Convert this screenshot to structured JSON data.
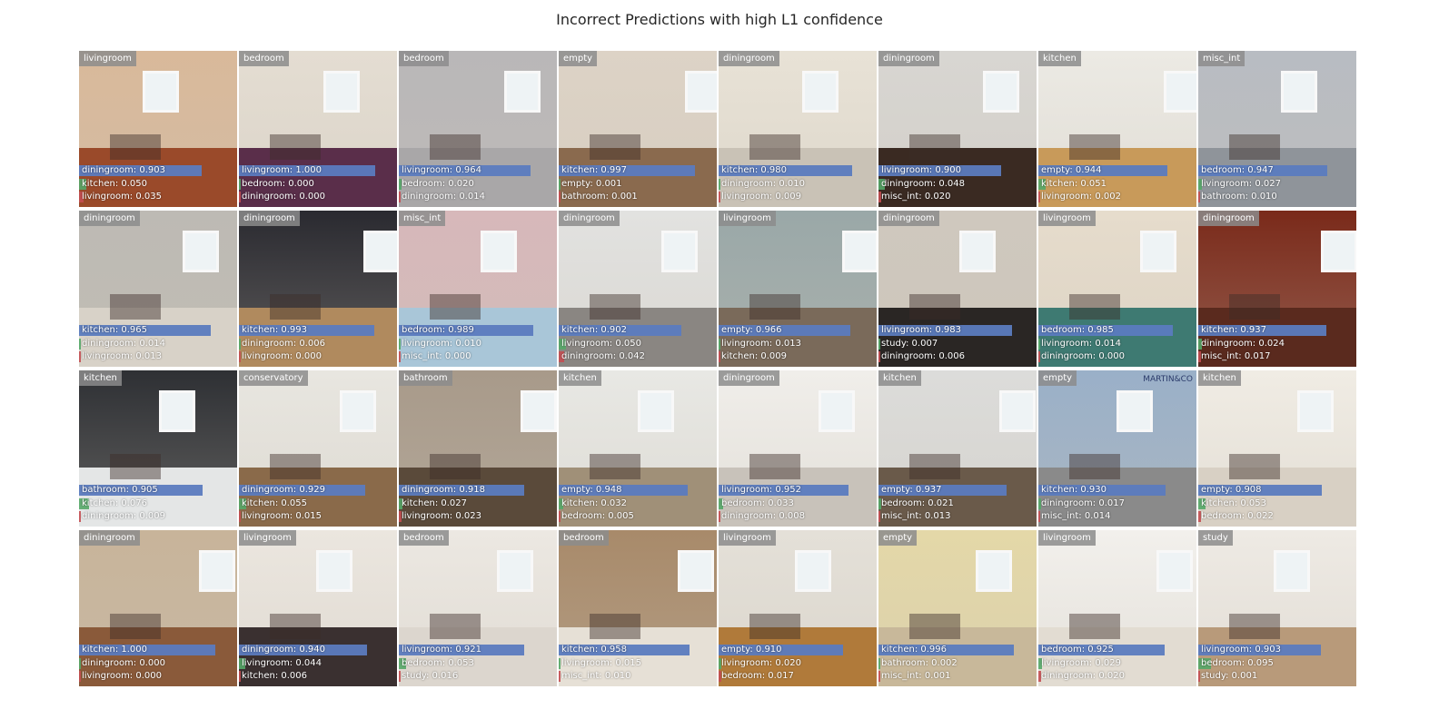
{
  "title": "Incorrect Predictions with high L1 confidence",
  "chart_data": {
    "type": "other",
    "title": "Incorrect Predictions with high L1 confidence",
    "grid": {
      "rows": 4,
      "cols": 8
    },
    "bar_colors": {
      "top": "#5b7bbf",
      "second": "#55a868",
      "third": "#c44e52"
    },
    "items": [
      {
        "truth": "livingroom",
        "palette": [
          "#d9b99a",
          "#9a4a2a"
        ],
        "preds": [
          {
            "label": "diningroom",
            "score": 0.903
          },
          {
            "label": "kitchen",
            "score": 0.05
          },
          {
            "label": "livingroom",
            "score": 0.035
          }
        ],
        "pred_text": [
          "diningroom: 0.903",
          "kitchen: 0.050",
          "livingroom: 0.035"
        ]
      },
      {
        "truth": "bedroom",
        "palette": [
          "#e4ddd2",
          "#5a2e4a"
        ],
        "preds": [
          {
            "label": "livingroom",
            "score": 1.0
          },
          {
            "label": "bedroom",
            "score": 0.0
          },
          {
            "label": "diningroom",
            "score": 0.0
          }
        ],
        "pred_text": [
          "livingroom: 1.000",
          "bedroom: 0.000",
          "diningroom: 0.000"
        ]
      },
      {
        "truth": "bedroom",
        "palette": [
          "#b9b7b8",
          "#a9a7a8"
        ],
        "preds": [
          {
            "label": "livingroom",
            "score": 0.964
          },
          {
            "label": "bedroom",
            "score": 0.02
          },
          {
            "label": "diningroom",
            "score": 0.014
          }
        ],
        "pred_text": [
          "livingroom: 0.964",
          "bedroom: 0.020",
          "diningroom: 0.014"
        ]
      },
      {
        "truth": "empty",
        "palette": [
          "#ddd3c6",
          "#8a6a4e"
        ],
        "preds": [
          {
            "label": "kitchen",
            "score": 0.997
          },
          {
            "label": "empty",
            "score": 0.001
          },
          {
            "label": "bathroom",
            "score": 0.001
          }
        ],
        "pred_text": [
          "kitchen: 0.997",
          "empty: 0.001",
          "bathroom: 0.001"
        ]
      },
      {
        "truth": "diningroom",
        "palette": [
          "#e8e2d6",
          "#c9c2b6"
        ],
        "preds": [
          {
            "label": "kitchen",
            "score": 0.98
          },
          {
            "label": "diningroom",
            "score": 0.01
          },
          {
            "label": "livingroom",
            "score": 0.009
          }
        ],
        "pred_text": [
          "kitchen: 0.980",
          "diningroom: 0.010",
          "livingroom: 0.009"
        ]
      },
      {
        "truth": "diningroom",
        "palette": [
          "#d8d6d2",
          "#3a2a22"
        ],
        "preds": [
          {
            "label": "livingroom",
            "score": 0.9
          },
          {
            "label": "diningroom",
            "score": 0.048
          },
          {
            "label": "misc_int",
            "score": 0.02
          }
        ],
        "pred_text": [
          "livingroom: 0.900",
          "diningroom: 0.048",
          "misc_int: 0.020"
        ]
      },
      {
        "truth": "kitchen",
        "palette": [
          "#eceae4",
          "#c89a5a"
        ],
        "preds": [
          {
            "label": "empty",
            "score": 0.944
          },
          {
            "label": "kitchen",
            "score": 0.051
          },
          {
            "label": "livingroom",
            "score": 0.002
          }
        ],
        "pred_text": [
          "empty: 0.944",
          "kitchen: 0.051",
          "livingroom: 0.002"
        ]
      },
      {
        "truth": "misc_int",
        "palette": [
          "#b8bcc2",
          "#8f949a"
        ],
        "preds": [
          {
            "label": "bedroom",
            "score": 0.947
          },
          {
            "label": "livingroom",
            "score": 0.027
          },
          {
            "label": "bathroom",
            "score": 0.01
          }
        ],
        "pred_text": [
          "bedroom: 0.947",
          "livingroom: 0.027",
          "bathroom: 0.010"
        ]
      },
      {
        "truth": "diningroom",
        "palette": [
          "#bdbab4",
          "#d8d2c8"
        ],
        "preds": [
          {
            "label": "kitchen",
            "score": 0.965
          },
          {
            "label": "diningroom",
            "score": 0.014
          },
          {
            "label": "livingroom",
            "score": 0.013
          }
        ],
        "pred_text": [
          "kitchen: 0.965",
          "diningroom: 0.014",
          "livingroom: 0.013"
        ]
      },
      {
        "truth": "diningroom",
        "palette": [
          "#2a2a30",
          "#b08a5e"
        ],
        "preds": [
          {
            "label": "kitchen",
            "score": 0.993
          },
          {
            "label": "diningroom",
            "score": 0.006
          },
          {
            "label": "livingroom",
            "score": 0.0
          }
        ],
        "pred_text": [
          "kitchen: 0.993",
          "diningroom: 0.006",
          "livingroom: 0.000"
        ]
      },
      {
        "truth": "misc_int",
        "palette": [
          "#d7b8ba",
          "#a9c6d8"
        ],
        "preds": [
          {
            "label": "bedroom",
            "score": 0.989
          },
          {
            "label": "livingroom",
            "score": 0.01
          },
          {
            "label": "misc_int",
            "score": 0.0
          }
        ],
        "pred_text": [
          "bedroom: 0.989",
          "livingroom: 0.010",
          "misc_int: 0.000"
        ]
      },
      {
        "truth": "diningroom",
        "palette": [
          "#e2e2e0",
          "#8a8682"
        ],
        "preds": [
          {
            "label": "kitchen",
            "score": 0.902
          },
          {
            "label": "livingroom",
            "score": 0.05
          },
          {
            "label": "diningroom",
            "score": 0.042
          }
        ],
        "pred_text": [
          "kitchen: 0.902",
          "livingroom: 0.050",
          "diningroom: 0.042"
        ]
      },
      {
        "truth": "livingroom",
        "palette": [
          "#9aa8a8",
          "#7a6a5a"
        ],
        "preds": [
          {
            "label": "empty",
            "score": 0.966
          },
          {
            "label": "livingroom",
            "score": 0.013
          },
          {
            "label": "kitchen",
            "score": 0.009
          }
        ],
        "pred_text": [
          "empty: 0.966",
          "livingroom: 0.013",
          "kitchen: 0.009"
        ]
      },
      {
        "truth": "diningroom",
        "palette": [
          "#cfc8be",
          "#2a2624"
        ],
        "preds": [
          {
            "label": "livingroom",
            "score": 0.983
          },
          {
            "label": "study",
            "score": 0.007
          },
          {
            "label": "diningroom",
            "score": 0.006
          }
        ],
        "pred_text": [
          "livingroom: 0.983",
          "study: 0.007",
          "diningroom: 0.006"
        ]
      },
      {
        "truth": "livingroom",
        "palette": [
          "#e6dccc",
          "#3e7a72"
        ],
        "preds": [
          {
            "label": "bedroom",
            "score": 0.985
          },
          {
            "label": "livingroom",
            "score": 0.014
          },
          {
            "label": "diningroom",
            "score": 0.0
          }
        ],
        "pred_text": [
          "bedroom: 0.985",
          "livingroom: 0.014",
          "diningroom: 0.000"
        ]
      },
      {
        "truth": "diningroom",
        "palette": [
          "#7a2a1a",
          "#5a2a1e"
        ],
        "preds": [
          {
            "label": "kitchen",
            "score": 0.937
          },
          {
            "label": "diningroom",
            "score": 0.024
          },
          {
            "label": "misc_int",
            "score": 0.017
          }
        ],
        "pred_text": [
          "kitchen: 0.937",
          "diningroom: 0.024",
          "misc_int: 0.017"
        ]
      },
      {
        "truth": "kitchen",
        "palette": [
          "#2e3034",
          "#e4e6e6"
        ],
        "preds": [
          {
            "label": "bathroom",
            "score": 0.905
          },
          {
            "label": "kitchen",
            "score": 0.076
          },
          {
            "label": "diningroom",
            "score": 0.009
          }
        ],
        "pred_text": [
          "bathroom: 0.905",
          "kitchen: 0.076",
          "diningroom: 0.009"
        ]
      },
      {
        "truth": "conservatory",
        "palette": [
          "#e8e6e0",
          "#8a6a4a"
        ],
        "preds": [
          {
            "label": "diningroom",
            "score": 0.929
          },
          {
            "label": "kitchen",
            "score": 0.055
          },
          {
            "label": "livingroom",
            "score": 0.015
          }
        ],
        "pred_text": [
          "diningroom: 0.929",
          "kitchen: 0.055",
          "livingroom: 0.015"
        ]
      },
      {
        "truth": "bathroom",
        "palette": [
          "#a89a8a",
          "#5a4a3a"
        ],
        "preds": [
          {
            "label": "diningroom",
            "score": 0.918
          },
          {
            "label": "kitchen",
            "score": 0.027
          },
          {
            "label": "livingroom",
            "score": 0.023
          }
        ],
        "pred_text": [
          "diningroom: 0.918",
          "kitchen: 0.027",
          "livingroom: 0.023"
        ]
      },
      {
        "truth": "kitchen",
        "palette": [
          "#e8e8e4",
          "#a09078"
        ],
        "preds": [
          {
            "label": "empty",
            "score": 0.948
          },
          {
            "label": "kitchen",
            "score": 0.032
          },
          {
            "label": "bedroom",
            "score": 0.005
          }
        ],
        "pred_text": [
          "empty: 0.948",
          "kitchen: 0.032",
          "bedroom: 0.005"
        ]
      },
      {
        "truth": "diningroom",
        "palette": [
          "#f0eeea",
          "#c8c2ba"
        ],
        "preds": [
          {
            "label": "livingroom",
            "score": 0.952
          },
          {
            "label": "bedroom",
            "score": 0.033
          },
          {
            "label": "diningroom",
            "score": 0.008
          }
        ],
        "pred_text": [
          "livingroom: 0.952",
          "bedroom: 0.033",
          "diningroom: 0.008"
        ]
      },
      {
        "truth": "kitchen",
        "palette": [
          "#dcdcda",
          "#6a5a4a"
        ],
        "preds": [
          {
            "label": "empty",
            "score": 0.937
          },
          {
            "label": "bedroom",
            "score": 0.021
          },
          {
            "label": "misc_int",
            "score": 0.013
          }
        ],
        "pred_text": [
          "empty: 0.937",
          "bedroom: 0.021",
          "misc_int: 0.013"
        ]
      },
      {
        "truth": "empty",
        "palette": [
          "#9ab0c8",
          "#8a8a8a"
        ],
        "preds": [
          {
            "label": "kitchen",
            "score": 0.93
          },
          {
            "label": "diningroom",
            "score": 0.017
          },
          {
            "label": "misc_int",
            "score": 0.014
          }
        ],
        "pred_text": [
          "kitchen: 0.930",
          "diningroom: 0.017",
          "misc_int: 0.014"
        ],
        "overlay_text": "MARTIN&CO"
      },
      {
        "truth": "kitchen",
        "palette": [
          "#f0ece4",
          "#d8d0c4"
        ],
        "preds": [
          {
            "label": "empty",
            "score": 0.908
          },
          {
            "label": "kitchen",
            "score": 0.053
          },
          {
            "label": "bedroom",
            "score": 0.022
          }
        ],
        "pred_text": [
          "empty: 0.908",
          "kitchen: 0.053",
          "bedroom: 0.022"
        ]
      },
      {
        "truth": "diningroom",
        "palette": [
          "#c8b49a",
          "#8a5a3a"
        ],
        "preds": [
          {
            "label": "kitchen",
            "score": 1.0
          },
          {
            "label": "diningroom",
            "score": 0.0
          },
          {
            "label": "livingroom",
            "score": 0.0
          }
        ],
        "pred_text": [
          "kitchen: 1.000",
          "diningroom: 0.000",
          "livingroom: 0.000"
        ]
      },
      {
        "truth": "livingroom",
        "palette": [
          "#ebe6df",
          "#3a3030"
        ],
        "preds": [
          {
            "label": "diningroom",
            "score": 0.94
          },
          {
            "label": "livingroom",
            "score": 0.044
          },
          {
            "label": "kitchen",
            "score": 0.006
          }
        ],
        "pred_text": [
          "diningroom: 0.940",
          "livingroom: 0.044",
          "kitchen: 0.006"
        ]
      },
      {
        "truth": "bedroom",
        "palette": [
          "#ece8e2",
          "#dcd6ce"
        ],
        "preds": [
          {
            "label": "livingroom",
            "score": 0.921
          },
          {
            "label": "bedroom",
            "score": 0.053
          },
          {
            "label": "study",
            "score": 0.016
          }
        ],
        "pred_text": [
          "livingroom: 0.921",
          "bedroom: 0.053",
          "study: 0.016"
        ]
      },
      {
        "truth": "bedroom",
        "palette": [
          "#a88a6a",
          "#e6e0d6"
        ],
        "preds": [
          {
            "label": "kitchen",
            "score": 0.958
          },
          {
            "label": "livingroom",
            "score": 0.015
          },
          {
            "label": "misc_int",
            "score": 0.01
          }
        ],
        "pred_text": [
          "kitchen: 0.958",
          "livingroom: 0.015",
          "misc_int: 0.010"
        ]
      },
      {
        "truth": "livingroom",
        "palette": [
          "#e4e0d8",
          "#b07a3a"
        ],
        "preds": [
          {
            "label": "empty",
            "score": 0.91
          },
          {
            "label": "livingroom",
            "score": 0.02
          },
          {
            "label": "bedroom",
            "score": 0.017
          }
        ],
        "pred_text": [
          "empty: 0.910",
          "livingroom: 0.020",
          "bedroom: 0.017"
        ]
      },
      {
        "truth": "empty",
        "palette": [
          "#e4d8a8",
          "#c8b89a"
        ],
        "preds": [
          {
            "label": "kitchen",
            "score": 0.996
          },
          {
            "label": "bathroom",
            "score": 0.002
          },
          {
            "label": "misc_int",
            "score": 0.001
          }
        ],
        "pred_text": [
          "kitchen: 0.996",
          "bathroom: 0.002",
          "misc_int: 0.001"
        ]
      },
      {
        "truth": "livingroom",
        "palette": [
          "#f2f0ec",
          "#e2dcd2"
        ],
        "preds": [
          {
            "label": "bedroom",
            "score": 0.925
          },
          {
            "label": "livingroom",
            "score": 0.029
          },
          {
            "label": "diningroom",
            "score": 0.02
          }
        ],
        "pred_text": [
          "bedroom: 0.925",
          "livingroom: 0.029",
          "diningroom: 0.020"
        ]
      },
      {
        "truth": "study",
        "palette": [
          "#eeeae4",
          "#b89a7a"
        ],
        "preds": [
          {
            "label": "livingroom",
            "score": 0.903
          },
          {
            "label": "bedroom",
            "score": 0.095
          },
          {
            "label": "study",
            "score": 0.001
          }
        ],
        "pred_text": [
          "livingroom: 0.903",
          "bedroom: 0.095",
          "study: 0.001"
        ]
      }
    ]
  }
}
